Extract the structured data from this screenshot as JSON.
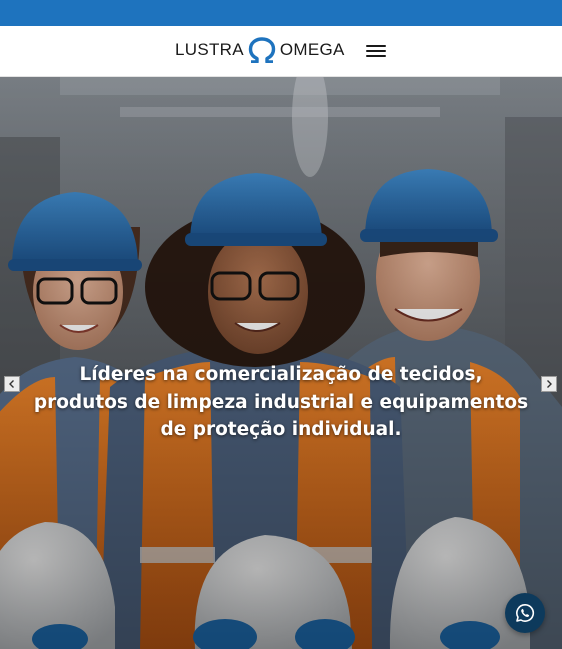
{
  "brand": {
    "name_left": "LUSTRA",
    "name_right": "OMEGA",
    "symbol_icon": "omega-icon",
    "accent_color": "#1e73be"
  },
  "header": {
    "menu_icon": "hamburger-menu-icon"
  },
  "hero": {
    "caption": "Líderes na comercialização de tecidos, produtos de limpeza industrial e equipamentos de proteção individual.",
    "image_subject": "three workers in blue helmets and orange safety vests holding white helmets",
    "prev_icon": "chevron-left-icon",
    "next_icon": "chevron-right-icon"
  },
  "floating": {
    "whatsapp_icon": "whatsapp-icon",
    "whatsapp_color": "#0d3a5c"
  }
}
